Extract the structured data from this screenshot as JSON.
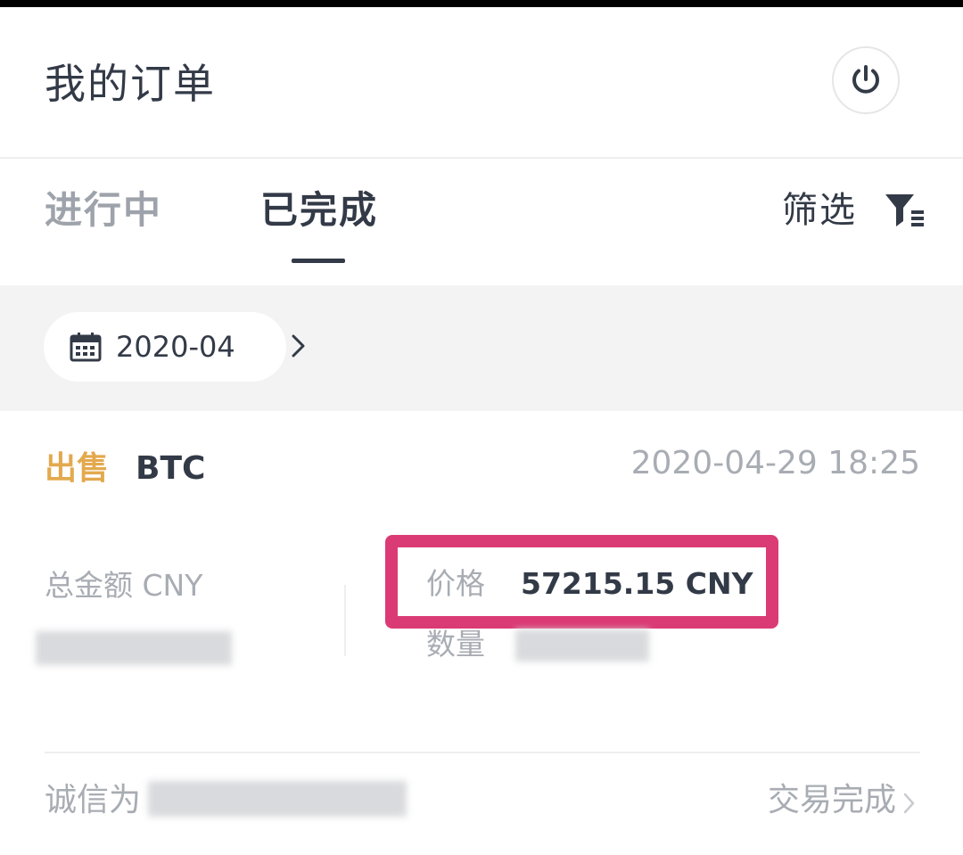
{
  "header": {
    "title": "我的订单",
    "logout_icon": "power-icon"
  },
  "tabs": [
    {
      "label": "进行中",
      "active": false
    },
    {
      "label": "已完成",
      "active": true
    }
  ],
  "filter": {
    "label": "筛选",
    "icon": "filter-list-icon"
  },
  "date_picker": {
    "value": "2020-04",
    "icon": "calendar-icon"
  },
  "order": {
    "side": "出售",
    "coin": "BTC",
    "time": "2020-04-29 18:25",
    "total_label": "总金额 CNY",
    "price_label": "价格",
    "price_value": "57215.15 CNY",
    "quantity_label": "数量",
    "merchant_prefix": "诚信为",
    "status": "交易完成"
  },
  "colors": {
    "accent_sell": "#e3a94e",
    "highlight": "#db3b74",
    "text_primary": "#333a47",
    "text_secondary": "#a8acb3"
  }
}
